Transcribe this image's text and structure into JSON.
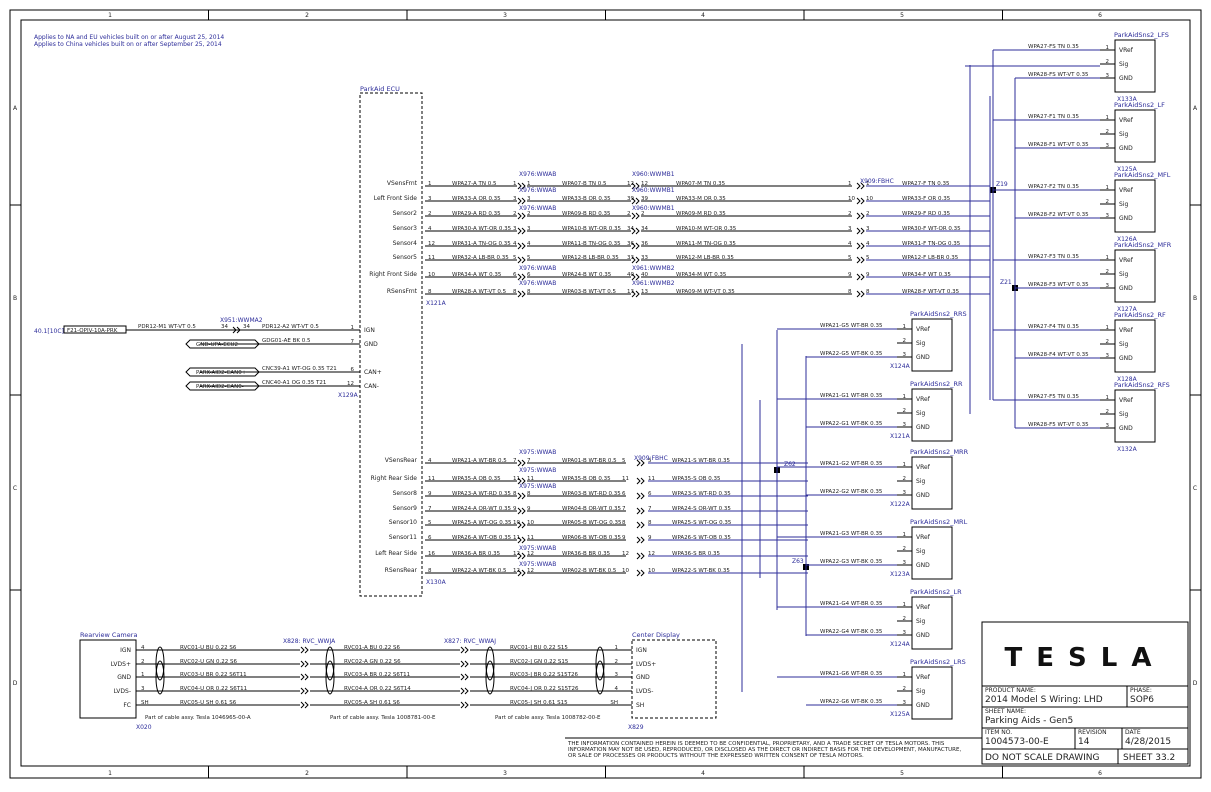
{
  "notes": [
    "Applies to NA and EU vehicles built on or after August 25, 2014",
    "Applies to China vehicles built on or after September 25, 2014"
  ],
  "grid_cols": [
    "1",
    "2",
    "3",
    "4",
    "5",
    "6"
  ],
  "grid_rows": [
    "A",
    "B",
    "C",
    "D"
  ],
  "ecu": {
    "title": "ParkAid ECU",
    "id_front": "X121A",
    "id_rear": "X130A",
    "id_pwr": "X129A",
    "front_pins": [
      [
        "VSensFrnt",
        "1"
      ],
      [
        "Left Front Side",
        "3"
      ],
      [
        "Sensor2",
        "2"
      ],
      [
        "Sensor3",
        "4"
      ],
      [
        "Sensor4",
        "12"
      ],
      [
        "Sensor5",
        "11"
      ],
      [
        "Right Front Side",
        "10"
      ],
      [
        "RSensFrnt",
        "8"
      ]
    ],
    "rear_pins": [
      [
        "VSensRear",
        "4"
      ],
      [
        "Right Rear Side",
        "11"
      ],
      [
        "Sensor8",
        "9"
      ],
      [
        "Sensor9",
        "7"
      ],
      [
        "Sensor10",
        "5"
      ],
      [
        "Sensor11",
        "6"
      ],
      [
        "Left Rear Side",
        "16"
      ],
      [
        "RSensRear",
        "8"
      ]
    ],
    "pwr_pins": [
      [
        "IGN",
        "1"
      ],
      [
        "GND",
        "7"
      ],
      [
        "CAN+",
        "6"
      ],
      [
        "CAN-",
        "12"
      ]
    ]
  },
  "pwr_wires": [
    "PDR12-M1 WT-VT 0.5",
    "PDR12-A2 WT-VT 0.5",
    "GDG01-AE BK 0.5",
    "CNC39-A1 WT-OG 0.35 T21",
    "CNC40-A1 OG 0.35 T21"
  ],
  "pwr_src": {
    "fuse": "40.1[10C]",
    "fuse_box": "F21-OPIV-10A-PRK",
    "conn": "X951:WWMA2",
    "pins": [
      "34",
      "34"
    ],
    "gnd": "GND-UPA-ECU2",
    "can_hi": "PARK-AID2-CAN0+",
    "can_lo": "PARK-AID2-CAN0-"
  },
  "front_wires": [
    [
      "WPA27-A TN 0.5",
      "WPA07-B TN 0.5",
      "WPA07-M TN 0.35",
      "WPA27-F TN 0.35"
    ],
    [
      "WPA33-A OR 0.35",
      "WPA33-B OR 0.35",
      "WPA33-M OR 0.35",
      "WPA33-F OR 0.35"
    ],
    [
      "WPA29-A RD 0.35",
      "WPA09-B RD 0.35",
      "WPA09-M RD 0.35",
      "WPA29-F RD 0.35"
    ],
    [
      "WPA30-A WT-OR 0.35",
      "WPA10-B WT-OR 0.35",
      "WPA10-M WT-OR 0.35",
      "WPA30-F WT-OR 0.35"
    ],
    [
      "WPA31-A TN-OG 0.35",
      "WPA11-B TN-OG 0.35",
      "WPA11-M TN-OG 0.35",
      "WPA31-F TN-OG 0.35"
    ],
    [
      "WPA32-A LB-BR 0.35",
      "WPA12-B LB-BR 0.35",
      "WPA12-M LB-BR 0.35",
      "WPA12-F LB-BR 0.35"
    ],
    [
      "WPA34-A WT 0.35",
      "WPA24-B WT 0.35",
      "WPA34-M WT 0.35",
      "WPA34-F WT 0.35"
    ],
    [
      "WPA28-A WT-VT 0.5",
      "WPA03-B WT-VT 0.5",
      "WPA09-M WT-VT 0.35",
      "WPA28-F WT-VT 0.35"
    ]
  ],
  "front_pin_nums": [
    [
      "1",
      "1",
      "12",
      "12",
      "1",
      "1"
    ],
    [
      "3",
      "3",
      "39",
      "39",
      "10",
      "10"
    ],
    [
      "2",
      "2",
      "2",
      "2",
      "2",
      "2"
    ],
    [
      "3",
      "3",
      "34",
      "34",
      "3",
      "3"
    ],
    [
      "4",
      "4",
      "36",
      "36",
      "4",
      "4"
    ],
    [
      "5",
      "5",
      "33",
      "33",
      "5",
      "5"
    ],
    [
      "6",
      "6",
      "40",
      "40",
      "9",
      "9"
    ],
    [
      "8",
      "8",
      "13",
      "13",
      "8",
      "8"
    ]
  ],
  "front_conns": {
    "c1": "X976:WWAB",
    "c2": "X960:WWMB1",
    "c3": "X909:FBHC",
    "c1b": "X976:WWAB",
    "c2b": "X961:WWMB2"
  },
  "rear_wires": [
    [
      "WPA21-A WT-BR 0.5",
      "WPA01-B WT-BR 0.5",
      "WPA21-S WT-BR 0.35"
    ],
    [
      "WPA35-A OB 0.35",
      "WPA35-B OB 0.35",
      "WPA35-S OB 0.35"
    ],
    [
      "WPA23-A WT-RD 0.35",
      "WPA03-B WT-RD 0.35",
      "WPA23-S WT-RD 0.35"
    ],
    [
      "WPA24-A OR-WT 0.35",
      "WPA04-B OR-WT 0.35",
      "WPA24-S OR-WT 0.35"
    ],
    [
      "WPA25-A WT-OG 0.35",
      "WPA05-B WT-OG 0.35",
      "WPA25-S WT-OG 0.35"
    ],
    [
      "WPA26-A WT-OB 0.35",
      "WPA06-B WT-OB 0.35",
      "WPA26-S WT-OB 0.35"
    ],
    [
      "WPA36-A BR 0.35",
      "WPA36-B BR 0.35",
      "WPA36-S BR 0.35"
    ],
    [
      "WPA22-A WT-BK 0.5",
      "WPA02-B WT-BK 0.5",
      "WPA22-S WT-BK 0.35"
    ]
  ],
  "rear_pin_nums": [
    [
      "7",
      "7",
      "5",
      "5"
    ],
    [
      "11",
      "11",
      "11",
      "11"
    ],
    [
      "8",
      "8",
      "6",
      "6"
    ],
    [
      "9",
      "9",
      "7",
      "7"
    ],
    [
      "10",
      "10",
      "8",
      "8"
    ],
    [
      "11",
      "11",
      "9",
      "9"
    ],
    [
      "12",
      "12",
      "12",
      "12"
    ],
    [
      "12",
      "12",
      "10",
      "10"
    ]
  ],
  "rear_conns": {
    "c1": "X975:WWAB",
    "c2": "X909:FBHC"
  },
  "splices": {
    "z19": "Z19",
    "z21": "Z21",
    "z62": "Z62",
    "z63": "Z63"
  },
  "front_sensors": [
    {
      "name": "ParkAidSns2_LFS",
      "id": "X133A",
      "wires": [
        "WPA27-FS TN 0.35",
        "WPA28-FS WT-VT 0.35"
      ]
    },
    {
      "name": "ParkAidSns2_LF",
      "id": "X125A",
      "wires": [
        "WPA27-F1 TN 0.35",
        "WPA28-F1 WT-VT 0.35"
      ]
    },
    {
      "name": "ParkAidSns2_MFL",
      "id": "X126A",
      "wires": [
        "WPA27-F2 TN 0.35",
        "WPA28-F2 WT-VT 0.35"
      ]
    },
    {
      "name": "ParkAidSns2_MFR",
      "id": "X127A",
      "wires": [
        "WPA27-F3 TN 0.35",
        "WPA28-F3 WT-VT 0.35"
      ]
    },
    {
      "name": "ParkAidSns2_RF",
      "id": "X128A",
      "wires": [
        "WPA27-F4 TN 0.35",
        "WPA28-F4 WT-VT 0.35"
      ]
    },
    {
      "name": "ParkAidSns2_RFS",
      "id": "X132A",
      "wires": [
        "WPA27-F5 TN 0.35",
        "WPA28-F5 WT-VT 0.35"
      ]
    }
  ],
  "rear_sensors": [
    {
      "name": "ParkAidSns2_RRS",
      "id": "X124A",
      "wires": [
        "WPA21-G5 WT-BR 0.35",
        "WPA22-G5 WT-BK 0.35"
      ]
    },
    {
      "name": "ParkAidSns2_RR",
      "id": "X121A",
      "wires": [
        "WPA21-G1 WT-BR 0.35",
        "WPA22-G1 WT-BK 0.35"
      ]
    },
    {
      "name": "ParkAidSns2_MRR",
      "id": "X122A",
      "wires": [
        "WPA21-G2 WT-BR 0.35",
        "WPA22-G2 WT-BK 0.35"
      ]
    },
    {
      "name": "ParkAidSns2_MRL",
      "id": "X123A",
      "wires": [
        "WPA21-G3 WT-BR 0.35",
        "WPA22-G3 WT-BK 0.35"
      ]
    },
    {
      "name": "ParkAidSns2_LR",
      "id": "X124A",
      "wires": [
        "WPA21-G4 WT-BR 0.35",
        "WPA22-G4 WT-BK 0.35"
      ]
    },
    {
      "name": "ParkAidSns2_LRS",
      "id": "X125A",
      "wires": [
        "WPA21-G6 WT-BR 0.35",
        "WPA22-G6 WT-BK 0.35"
      ]
    }
  ],
  "sensor_pins": [
    [
      "VRef",
      "1"
    ],
    [
      "Sig",
      "2"
    ],
    [
      "GND",
      "3"
    ]
  ],
  "camera": {
    "title": "Rearview Camera",
    "id": "X020",
    "pins": [
      [
        "IGN",
        "4"
      ],
      [
        "LVDS+",
        "2"
      ],
      [
        "GND",
        "1"
      ],
      [
        "LVDS-",
        "3"
      ],
      [
        "FC",
        "SH"
      ]
    ]
  },
  "display": {
    "title": "Center Display",
    "id": "X829",
    "pins": [
      [
        "IGN",
        "1"
      ],
      [
        "LVDS+",
        "2"
      ],
      [
        "GND",
        "3"
      ],
      [
        "LVDS-",
        "4"
      ],
      [
        "SH",
        "SH"
      ]
    ]
  },
  "camera_conns": {
    "c1": "X828: RVC_WWJA",
    "c2": "X827: RVC_WWAJ"
  },
  "camera_wires": [
    [
      "RVC01-U BU 0.22 S6",
      "RVC01-A BU 0.22 S6",
      "RVC01-J BU 0.22 S15"
    ],
    [
      "RVC02-U GN 0.22 S6",
      "RVC02-A GN 0.22 S6",
      "RVC02-J GN 0.22 S15"
    ],
    [
      "RVC03-U BR 0.22 S6T11",
      "RVC03-A BR 0.22 S6T11",
      "RVC03-J BR 0.22 S15T26"
    ],
    [
      "RVC04-U OR 0.22 S6T11",
      "RVC04-A OR 0.22 S6T14",
      "RVC04-J OR 0.22 S15T26"
    ],
    [
      "RVC05-U SH 0.61 S6",
      "RVC05-A SH 0.61 S6",
      "RVC05-J SH 0.61 S15"
    ]
  ],
  "cable_notes": [
    "Part of cable assy. Tesla 1046965-00-A",
    "Part of cable assy. Tesla 1008781-00-E",
    "Part of cable assy. Tesla 1008782-00-E"
  ],
  "disclaimer": [
    "THE INFORMATION CONTAINED HEREIN IS DEEMED TO BE CONFIDENTIAL, PROPRIETARY, AND A TRADE SECRET OF TESLA MOTORS. THIS",
    "INFORMATION MAY NOT BE USED, REPRODUCED, OR DISCLOSED AS THE DIRECT OR INDIRECT BASIS FOR THE DEVELOPMENT, MANUFACTURE,",
    "OR SALE OF PROCESSES OR PRODUCTS WITHOUT THE EXPRESSED WRITTEN CONSENT OF TESLA MOTORS."
  ],
  "title_block": {
    "logo": "TESLA",
    "product_label": "PRODUCT NAME:",
    "product": "2014 Model S Wiring: LHD",
    "phase_label": "PHASE:",
    "phase": "SOP6",
    "sheet_name_label": "SHEET NAME:",
    "sheet_name": "Parking Aids - Gen5",
    "item_label": "ITEM NO.",
    "item": "1004573-00-E",
    "rev_label": "REVISION",
    "rev": "14",
    "date_label": "DATE",
    "date": "4/28/2015",
    "dns": "DO NOT SCALE DRAWING",
    "sheet": "SHEET 33.2"
  }
}
